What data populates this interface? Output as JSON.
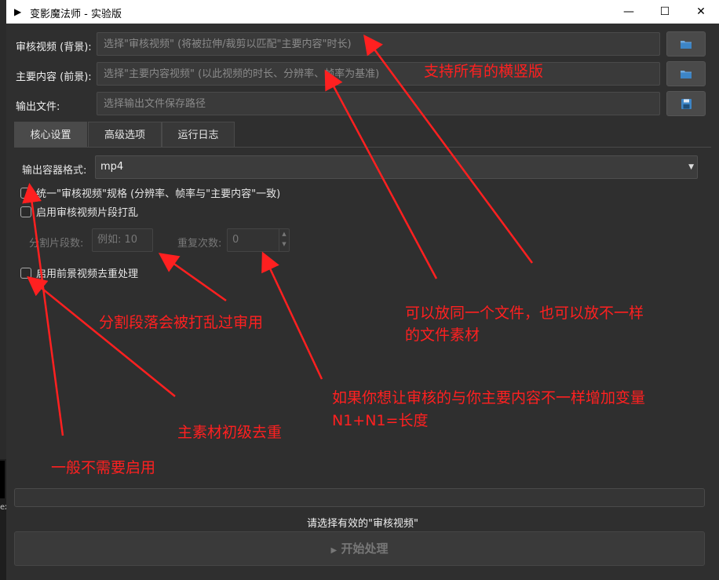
{
  "window": {
    "title": "变影魔法师 - 实验版",
    "app_icon": "▶",
    "minimize": "—",
    "maximize": "☐",
    "close": "✕"
  },
  "inputs": {
    "review_label": "审核视频 (背景):",
    "review_placeholder": "选择\"审核视频\" (将被拉伸/裁剪以匹配\"主要内容\"时长)",
    "main_label": "主要内容 (前景):",
    "main_placeholder": "选择\"主要内容视频\" (以此视频的时长、分辨率、帧率为基准)",
    "output_label": "输出文件:",
    "output_placeholder": "选择输出文件保存路径"
  },
  "icons": {
    "review_browse": "folder-icon",
    "main_browse": "folder-icon",
    "output_browse": "save-icon"
  },
  "tabs": [
    {
      "label": "核心设置"
    },
    {
      "label": "高级选项"
    },
    {
      "label": "运行日志"
    }
  ],
  "core": {
    "format_label": "输出容器格式:",
    "format_value": "mp4",
    "unify_label": "统一\"审核视频\"规格 (分辨率、帧率与\"主要内容\"一致)",
    "shuffle_label": "启用审核视频片段打乱",
    "segments_label": "分割片段数:",
    "segments_placeholder": "例如: 10",
    "repeat_label": "重复次数:",
    "repeat_value": "0",
    "dedup_label": "启用前景视频去重处理"
  },
  "annotations": [
    "支持所有的横竖版",
    "可以放同一个文件，也可以放不一样",
    "的文件素材",
    "分割段落会被打乱过审用",
    "如果你想让审核的与你主要内容不一样增加变量",
    "N1+N1=长度",
    "主素材初级去重",
    "一般不需要启用"
  ],
  "colors": {
    "annotation": "#ff2020",
    "background": "#2f2f2f"
  },
  "footer": {
    "status": "请选择有效的\"审核视频\"",
    "start_icon": "▶",
    "start_label": "开始处理"
  },
  "desktop": {
    "edge_text": "ex"
  }
}
